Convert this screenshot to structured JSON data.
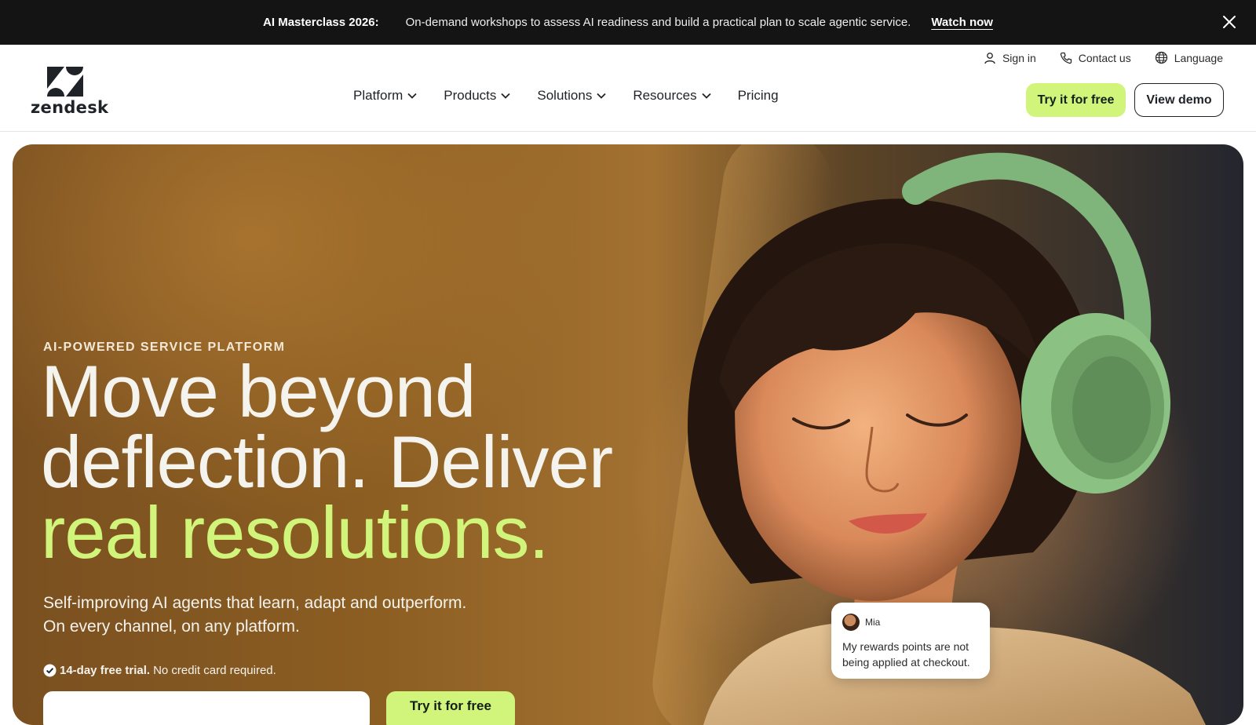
{
  "announcement": {
    "title": "AI Masterclass 2026:",
    "message": "On-demand workshops to assess AI readiness and build a practical plan to scale agentic service.",
    "cta": "Watch now"
  },
  "brand": {
    "name": "zendesk",
    "accent": "#d1f47a",
    "dark": "#141414"
  },
  "utility_nav": [
    {
      "label": "Sign in",
      "icon": "user-icon"
    },
    {
      "label": "Contact us",
      "icon": "phone-icon"
    },
    {
      "label": "Language",
      "icon": "globe-icon"
    }
  ],
  "main_nav": [
    {
      "label": "Platform",
      "has_dropdown": true
    },
    {
      "label": "Products",
      "has_dropdown": true
    },
    {
      "label": "Solutions",
      "has_dropdown": true
    },
    {
      "label": "Resources",
      "has_dropdown": true
    },
    {
      "label": "Pricing",
      "has_dropdown": false
    }
  ],
  "header_buttons": {
    "try": "Try it for free",
    "demo": "View demo"
  },
  "hero": {
    "eyebrow": "AI-POWERED SERVICE PLATFORM",
    "headline_line1": "Move beyond",
    "headline_line2": "deflection. Deliver",
    "headline_line3": "real resolutions.",
    "subhead_line1": "Self-improving AI agents that learn, adapt and outperform.",
    "subhead_line2": "On every channel, on any platform.",
    "trial_bold": "14-day free trial.",
    "trial_rest": "No credit card required.",
    "email_placeholder": "",
    "cta": "Try it for free"
  },
  "chat_card": {
    "name": "Mia",
    "message": "My rewards points are not being applied at checkout."
  }
}
